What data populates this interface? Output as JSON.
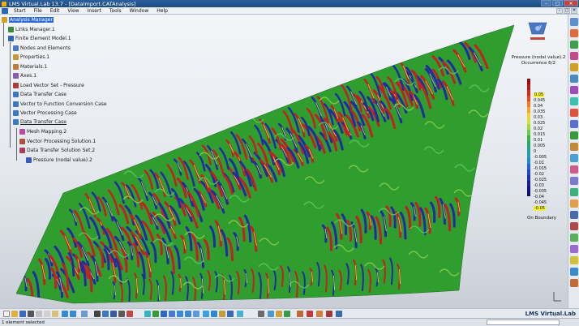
{
  "window": {
    "title": "LMS Virtual.Lab 13.7 - [DataImport.CATAnalysis]",
    "buttons": [
      "–",
      "▢",
      "✕"
    ]
  },
  "menu": {
    "items": [
      "Start",
      "File",
      "Edit",
      "View",
      "Insert",
      "Tools",
      "Window",
      "Help"
    ]
  },
  "tree": {
    "nodes": [
      {
        "label": "Analysis Manager",
        "icon": "analysis-manager-icon",
        "color": "#d0a020",
        "selected": true
      },
      {
        "label": "Links Manager.1",
        "icon": "links-manager-icon",
        "color": "#3b8a3b"
      },
      {
        "label": "Finite Element Model.1",
        "icon": "fe-model-icon",
        "color": "#2a66b8"
      },
      {
        "label": "Nodes and Elements",
        "icon": "nodes-elements-icon",
        "color": "#4a7ac0"
      },
      {
        "label": "Properties.1",
        "icon": "properties-icon",
        "color": "#c9963a"
      },
      {
        "label": "Materials.1",
        "icon": "materials-icon",
        "color": "#c07a3a"
      },
      {
        "label": "Axes.1",
        "icon": "axes-icon",
        "color": "#8a5ab0"
      },
      {
        "label": "Load Vector Set - Pressure",
        "icon": "load-vector-icon",
        "color": "#b03a3a"
      },
      {
        "label": "Data Transfer Case",
        "icon": "data-transfer-case-icon",
        "color": "#3a78c0"
      },
      {
        "label": "Vector to Function Conversion Case",
        "icon": "vector-conversion-icon",
        "color": "#3a78c0"
      },
      {
        "label": "Vector Processing Case",
        "icon": "vector-processing-case-icon",
        "color": "#3a78c0"
      },
      {
        "label": "Data Transfer Case",
        "icon": "data-transfer-case-icon",
        "color": "#3a78c0",
        "underlined": true
      },
      {
        "label": "Mesh Mapping.2",
        "icon": "mesh-mapping-icon",
        "color": "#c04aa0"
      },
      {
        "label": "Vector Processing Solution.1",
        "icon": "vector-processing-solution-icon",
        "color": "#b0503a"
      },
      {
        "label": "Data Transfer Solution Set.2",
        "icon": "data-transfer-solution-icon",
        "color": "#b03a5a"
      },
      {
        "label": "Pressure (nodal value).2",
        "icon": "pressure-result-icon",
        "color": "#3a5ac0"
      }
    ]
  },
  "legend": {
    "title_line1": "Pressure (nodal value).2",
    "title_line2": "Occurrence 6/2",
    "ticks": [
      "0.05",
      "0.045",
      "0.04",
      "0.035",
      "0.03",
      "0.025",
      "0.02",
      "0.015",
      "0.01",
      "0.005",
      "0",
      "-0.005",
      "-0.01",
      "-0.015",
      "-0.02",
      "-0.025",
      "-0.03",
      "-0.035",
      "-0.04",
      "-0.045",
      "-0.05"
    ],
    "footer": "On Boundary",
    "highlight_color": "#f4f03a"
  },
  "contour": {
    "band_colors": [
      "#1e8a1e",
      "#3aa83a",
      "#5cc45c",
      "#1f2d9e",
      "#c0221f",
      "#e0e04a",
      "#8acb4a"
    ]
  },
  "bottom_toolbar": {
    "brand": "LMS Virtual.Lab"
  },
  "status": {
    "text": "1 element selected"
  },
  "compass": {
    "axis_label": "y"
  }
}
